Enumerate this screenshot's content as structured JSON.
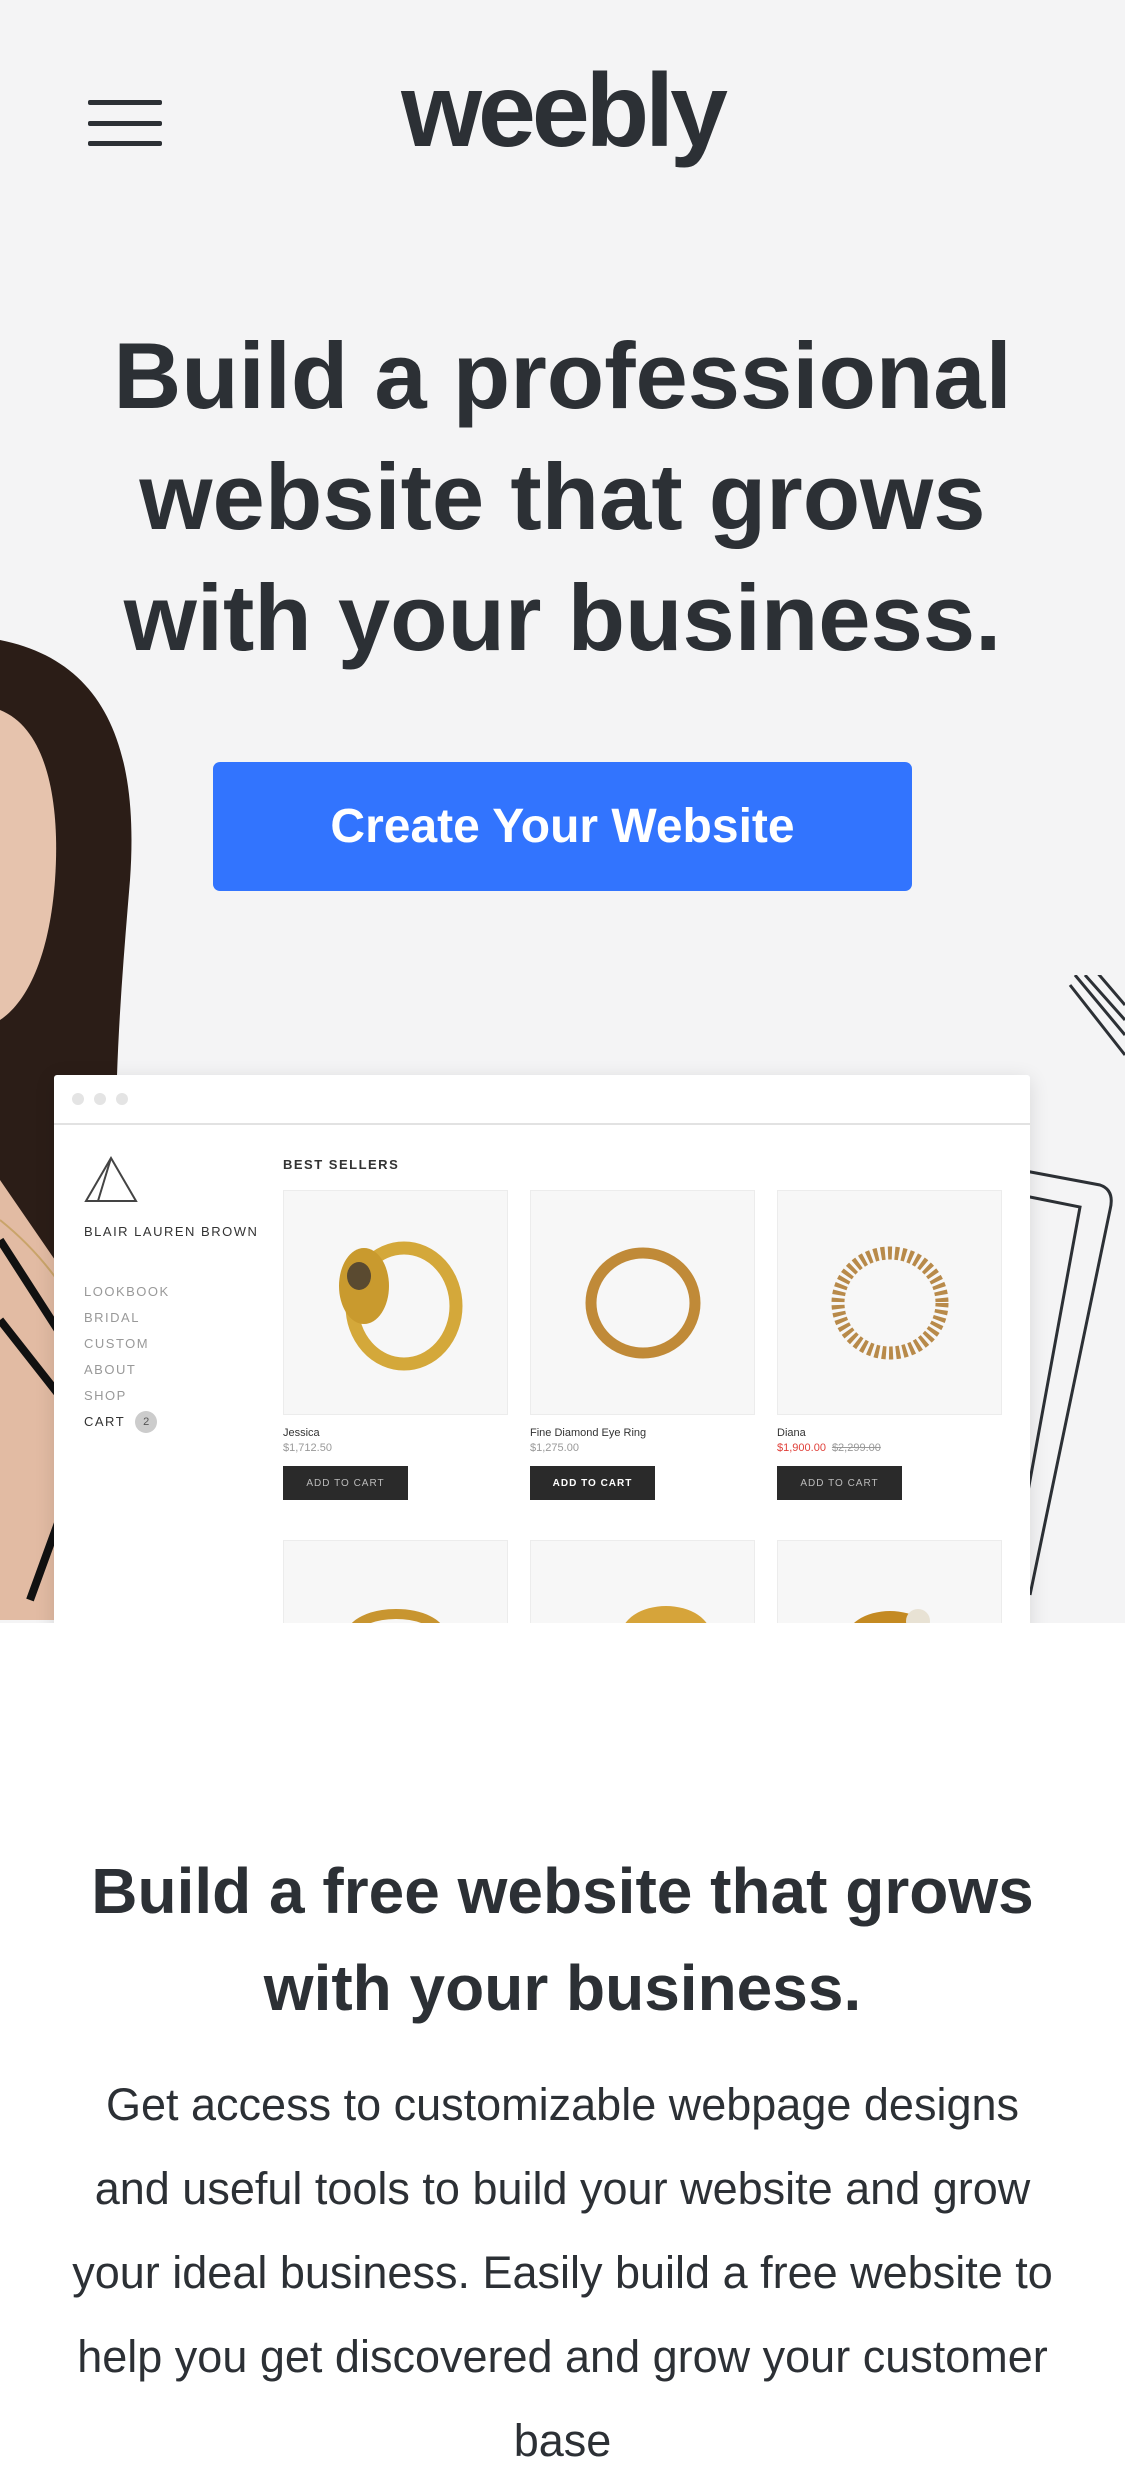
{
  "header": {
    "logo": "weebly",
    "menu_icon": "hamburger-menu-icon"
  },
  "hero": {
    "headline": "Build a professional website that grows with your business.",
    "cta_label": "Create Your Website",
    "cta_color": "#3274fe",
    "background": "#f4f4f5"
  },
  "store_preview": {
    "brand": "BLAIR LAUREN BROWN",
    "nav": [
      "LOOKBOOK",
      "BRIDAL",
      "CUSTOM",
      "ABOUT",
      "SHOP"
    ],
    "cart_label": "CART",
    "cart_count": "2",
    "section_title": "BEST SELLERS",
    "products": [
      {
        "name": "Jessica",
        "price": "$1,712.50",
        "old_price": "",
        "button": "ADD TO CART"
      },
      {
        "name": "Fine Diamond Eye Ring",
        "price": "$1,275.00",
        "old_price": "",
        "button": "ADD TO CART"
      },
      {
        "name": "Diana",
        "price": "$1,900.00",
        "old_price": "$2,299.00",
        "button": "ADD TO CART"
      }
    ]
  },
  "section2": {
    "title": "Build a free website that grows with your business.",
    "body": "Get access to customizable webpage designs and useful tools to build your website and grow your ideal business. Easily build a free website to help you get discovered and grow your customer base"
  }
}
